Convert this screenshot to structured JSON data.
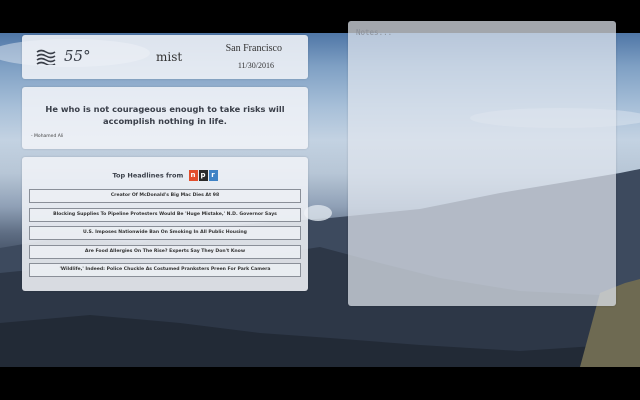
{
  "weather": {
    "temperature": "55°",
    "condition": "mist",
    "city": "San Francisco",
    "date": "11/30/2016",
    "icon": "mist-icon"
  },
  "quote": {
    "text": "He who is not courageous enough to take risks will accomplish nothing in life.",
    "author": "- Mohamed Ali"
  },
  "headlines": {
    "title": "Top Headlines from",
    "source_logo_letters": [
      "n",
      "p",
      "r"
    ],
    "items": [
      "Creator Of McDonald's Big Mac Dies At 98",
      "Blocking Supplies To Pipeline Protesters Would Be 'Huge Mistake,' N.D. Governor Says",
      "U.S. Imposes Nationwide Ban On Smoking In All Public Housing",
      "Are Food Allergies On The Rise? Experts Say They Don't Know",
      "'Wildlife,' Indeed: Police Chuckle As Costumed Pranksters Preen For Park Camera"
    ]
  },
  "notes": {
    "placeholder": "Notes..."
  },
  "colors": {
    "npr_n": "#e24e2c",
    "npr_p": "#2a2a2a",
    "npr_r": "#3f82c5"
  }
}
